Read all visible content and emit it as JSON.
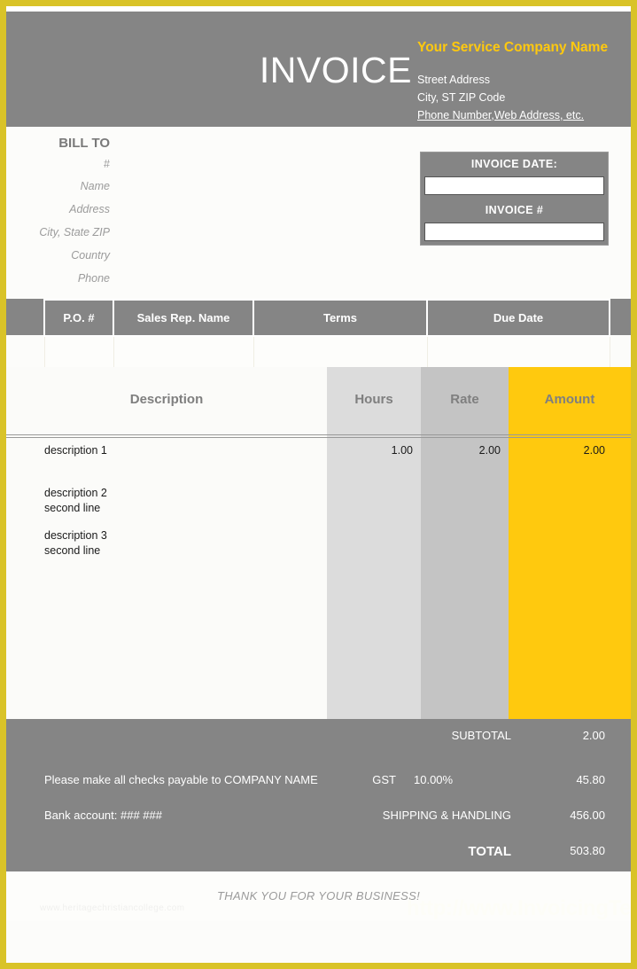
{
  "header": {
    "invoice_word": "INVOICE",
    "company_name": "Your Service Company Name",
    "address_line1": "Street Address",
    "address_line2": "City, ST  ZIP Code",
    "address_line3": "Phone Number,Web Address, etc."
  },
  "bill_to": {
    "title": "BILL TO",
    "fields": [
      {
        "label": "#"
      },
      {
        "label": "Name"
      },
      {
        "label": "Address"
      },
      {
        "label": "City, State ZIP"
      },
      {
        "label": "Country"
      },
      {
        "label": "Phone"
      }
    ]
  },
  "invoice_meta": {
    "date_label": "INVOICE DATE:",
    "date_value": "",
    "number_label": "INVOICE #",
    "number_value": ""
  },
  "po_table": {
    "headers": [
      "P.O. #",
      "Sales Rep. Name",
      "Terms",
      "Due Date"
    ],
    "row": [
      "",
      "",
      "",
      ""
    ]
  },
  "items_table": {
    "headers": {
      "description": "Description",
      "hours": "Hours",
      "rate": "Rate",
      "amount": "Amount"
    },
    "rows": [
      {
        "description": "description 1",
        "hours": "1.00",
        "rate": "2.00",
        "amount": "2.00"
      },
      {
        "description": "description 2\nsecond line",
        "hours": "",
        "rate": "",
        "amount": ""
      },
      {
        "description": "description 3\nsecond line",
        "hours": "",
        "rate": "",
        "amount": ""
      }
    ]
  },
  "totals": {
    "subtotal_label": "SUBTOTAL",
    "subtotal_value": "2.00",
    "payable_note": "Please make all checks payable to COMPANY NAME",
    "tax_label": "GST",
    "tax_rate": "10.00%",
    "tax_value": "45.80",
    "bank_note": "Bank account: ### ###",
    "shipping_label": "SHIPPING & HANDLING",
    "shipping_value": "456.00",
    "total_label": "TOTAL",
    "total_value": "503.80"
  },
  "footer": {
    "thanks": "THANK YOU FOR YOUR BUSINESS!",
    "watermark_left": "www.heritagechristiancollege.com",
    "watermark_right": "http://www.InvoicingTemplate.com"
  },
  "colors": {
    "border_yellow": "#d9c328",
    "accent_yellow": "#ffc90e",
    "gray_band": "#858585",
    "hours_col": "#dcdcdc",
    "rate_col": "#c4c4c4"
  }
}
